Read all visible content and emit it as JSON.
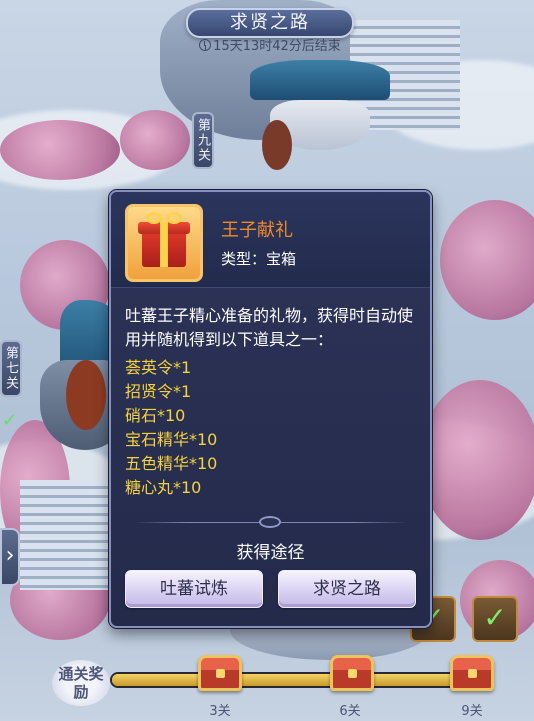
{
  "header": {
    "title": "求贤之路",
    "countdown": "15天13时42分后结束"
  },
  "stages": {
    "ninth": "第九关",
    "seventh": "第七关"
  },
  "item_popup": {
    "name": "王子献礼",
    "type_label": "类型：",
    "type_value": "宝箱",
    "description": "吐蕃王子精心准备的礼物，获得时自动使用并随机得到以下道具之一：",
    "rewards": [
      "荟英令*1",
      "招贤令*1",
      "硝石*10",
      "宝石精华*10",
      "五色精华*10",
      "糖心丸*10"
    ],
    "source_title": "获得途径",
    "source_buttons": [
      "吐蕃试炼",
      "求贤之路"
    ]
  },
  "progress": {
    "badge": "通关奖励",
    "fill_ratio": 1.0,
    "chests": [
      "3关",
      "6关",
      "9关"
    ]
  }
}
